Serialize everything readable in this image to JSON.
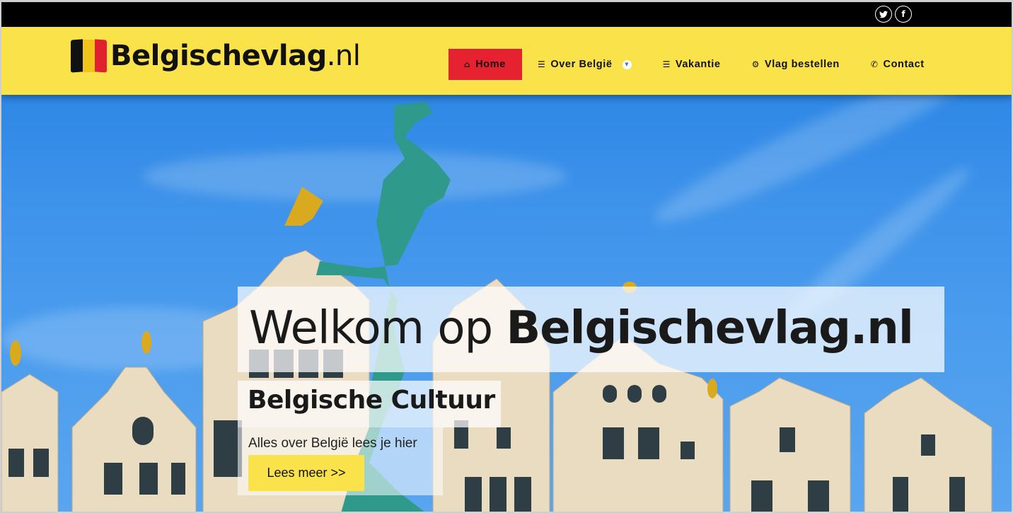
{
  "social": {
    "twitter_icon": "twitter-icon",
    "facebook_icon": "facebook-icon",
    "twitter_glyph": "🐦",
    "facebook_glyph": "f"
  },
  "logo": {
    "name": "Belgischevlag",
    "tld": ".nl"
  },
  "nav": {
    "items": [
      {
        "label": "Home",
        "icon": "home-icon",
        "active": true
      },
      {
        "label": "Over België",
        "icon": "list-icon",
        "has_dropdown": true
      },
      {
        "label": "Vakantie",
        "icon": "list-icon"
      },
      {
        "label": "Vlag bestellen",
        "icon": "gear-icon"
      },
      {
        "label": "Contact",
        "icon": "phone-icon"
      }
    ]
  },
  "hero": {
    "welcome_prefix": "Welkom op ",
    "welcome_brand": "Belgischevlag.nl",
    "culture_bold": "Belgische",
    "culture_rest": " Cultuur",
    "subtitle": "Alles over België lees je hier",
    "button_label": "Lees meer >>"
  },
  "colors": {
    "topbar": "#000000",
    "header": "#f9e24a",
    "active_nav": "#e62130",
    "sky": "#3d92ea",
    "button": "#f9e24a"
  }
}
